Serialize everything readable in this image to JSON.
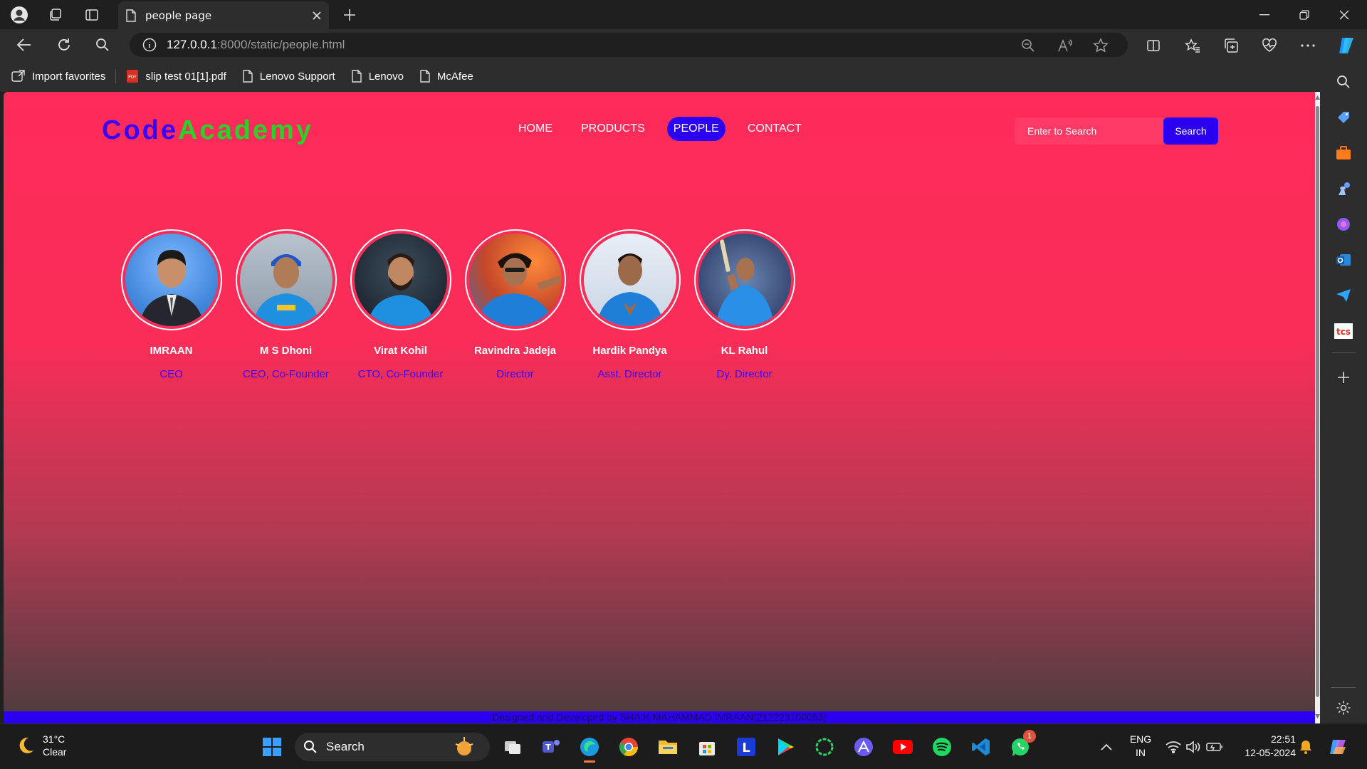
{
  "browser": {
    "tab_title": "people page",
    "url_host": "127.0.0.1",
    "url_path": ":8000/static/people.html",
    "bookmarks": [
      "Import favorites",
      "slip test 01[1].pdf",
      "Lenovo Support",
      "Lenovo",
      "McAfee"
    ]
  },
  "site": {
    "logo_part1": "Code",
    "logo_part2": "Academy",
    "nav": [
      "HOME",
      "PRODUCTS",
      "PEOPLE",
      "CONTACT"
    ],
    "active_nav": "PEOPLE",
    "search_placeholder": "Enter to Search",
    "search_button": "Search",
    "footer": "Designed and Developed by SHAIK MAHAMMAD IMRAAN(212223100053)"
  },
  "people": [
    {
      "name": "IMRAAN",
      "role": "CEO"
    },
    {
      "name": "M S Dhoni",
      "role": "CEO, Co-Founder"
    },
    {
      "name": "Virat Kohil",
      "role": "CTO, Co-Founder"
    },
    {
      "name": "Ravindra Jadeja",
      "role": "Director"
    },
    {
      "name": "Hardik Pandya",
      "role": "Asst. Director"
    },
    {
      "name": "KL Rahul",
      "role": "Dy. Director"
    }
  ],
  "taskbar": {
    "temperature": "31°C",
    "weather": "Clear",
    "search_label": "Search",
    "lang_1": "ENG",
    "lang_2": "IN",
    "time": "22:51",
    "date": "12-05-2024",
    "whatsapp_badge": "1"
  },
  "colors": {
    "page_top": "#ff2b5a",
    "page_bottom": "#4a3c3e",
    "accent_blue": "#2b00f0",
    "logo_green": "#2ad12a"
  }
}
